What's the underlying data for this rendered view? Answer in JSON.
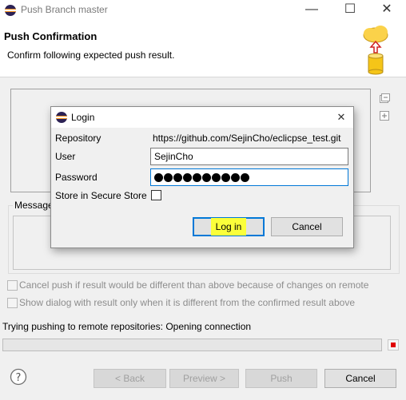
{
  "window": {
    "title": "Push Branch master",
    "minimize": "—",
    "maximize": "☐",
    "close": "✕"
  },
  "header": {
    "title": "Push Confirmation",
    "subtitle": "Confirm following expected push result."
  },
  "message_group": {
    "label": "Message"
  },
  "options": [
    {
      "label": "Cancel push if result would be different than above because of changes on remote",
      "checked": false,
      "enabled": false
    },
    {
      "label": "Show dialog with result only when it is different from the confirmed result above",
      "checked": false,
      "enabled": false
    }
  ],
  "status": {
    "text": "Trying pushing to remote repositories: Opening connection",
    "progress": 0,
    "stop_color": "#e00000"
  },
  "footer": {
    "help_icon": "question-circle-icon",
    "back": "< Back",
    "preview": "Preview >",
    "push": "Push",
    "cancel": "Cancel"
  },
  "side_icons": [
    "collapse-all-icon",
    "expand-all-icon"
  ],
  "login": {
    "title": "Login",
    "repository_label": "Repository",
    "repository_value": "https://github.com/SejinCho/eclicpse_test.git",
    "user_label": "User",
    "user_value": "SejinCho",
    "password_label": "Password",
    "password_length": 10,
    "store_label": "Store in Secure Store",
    "store_checked": false,
    "login_button": "Log in",
    "cancel_button": "Cancel",
    "close": "✕"
  },
  "colors": {
    "accent": "#0078d7",
    "highlight": "#fbff3a",
    "eclipse_purple": "#2c2255",
    "eclipse_orange": "#f7941e",
    "git_push_yellow": "#fbd24a"
  }
}
